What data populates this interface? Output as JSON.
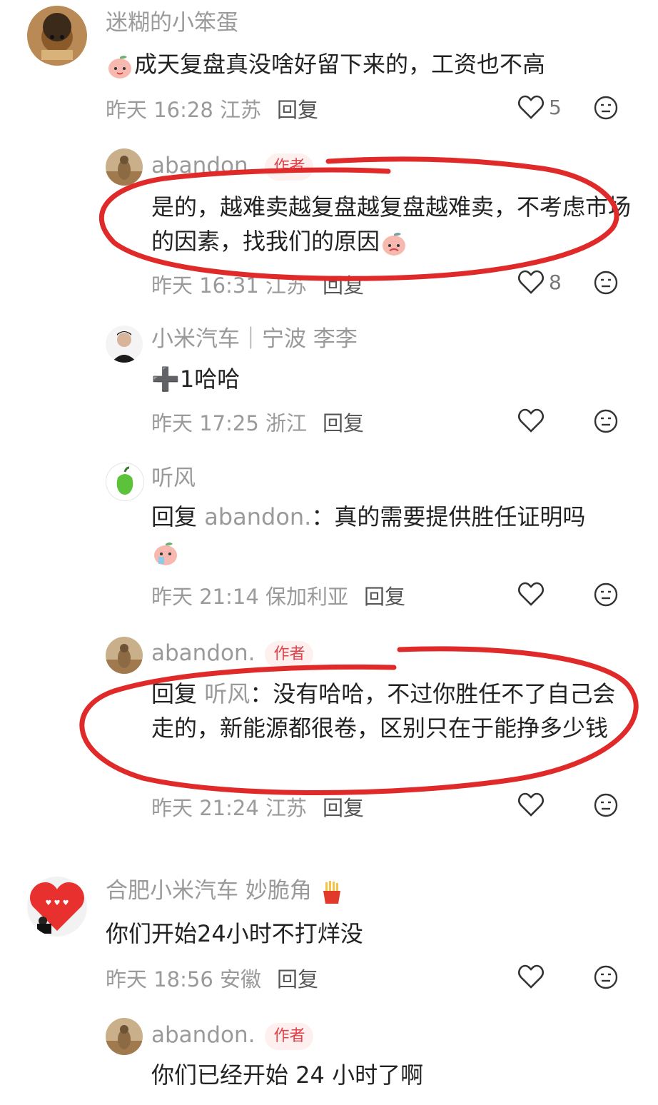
{
  "comments": [
    {
      "user": "迷糊的小笨蛋",
      "text": "成天复盘真没啥好留下来的，工资也不高",
      "time": "昨天 16:28 江苏",
      "reply_label": "回复",
      "likes": "5",
      "replies": [
        {
          "user": "abandon.",
          "tag": "作者",
          "text": "是的，越难卖越复盘越复盘越难卖，不考虑市场的因素，找我们的原因",
          "time": "昨天 16:31 江苏",
          "reply_label": "回复",
          "likes": "8"
        },
        {
          "user": "小米汽车｜宁波 李李",
          "text": "➕1哈哈",
          "time": "昨天 17:25 浙江",
          "reply_label": "回复"
        },
        {
          "user": "听风",
          "reply_prefix": "回复",
          "reply_target": "abandon.",
          "text": "：真的需要提供胜任证明吗",
          "time": "昨天 21:14 保加利亚",
          "reply_label": "回复"
        },
        {
          "user": "abandon.",
          "tag": "作者",
          "reply_prefix": "回复",
          "reply_target": "听风",
          "text": "：没有哈哈，不过你胜任不了自己会走的，新能源都很卷，区别只在于能挣多少钱",
          "time": "昨天 21:24 江苏",
          "reply_label": "回复"
        }
      ]
    },
    {
      "user": "合肥小米汽车 妙脆角",
      "text": "你们开始24小时不打烊没",
      "time": "昨天 18:56 安徽",
      "reply_label": "回复",
      "replies": [
        {
          "user": "abandon.",
          "tag": "作者",
          "text": "你们已经开始 24 小时了啊"
        }
      ]
    }
  ],
  "colors": {
    "annotation": "#e02a2a",
    "author_tag": "#e0424a",
    "meta": "#9a9a9a"
  },
  "icons": [
    "heart-icon",
    "face-emoji-icon",
    "peach-emoji-icon",
    "pepper-avatar-icon",
    "fries-emoji-icon"
  ]
}
